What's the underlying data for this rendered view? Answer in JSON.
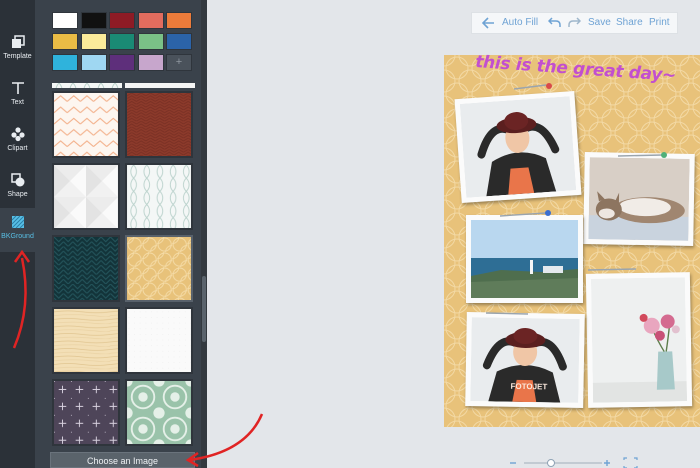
{
  "rail": {
    "items": [
      {
        "label": "Template",
        "icon": "template-icon"
      },
      {
        "label": "Text",
        "icon": "text-icon"
      },
      {
        "label": "Clipart",
        "icon": "clipart-icon"
      },
      {
        "label": "Shape",
        "icon": "shape-icon"
      },
      {
        "label": "BKGround",
        "icon": "background-icon"
      }
    ],
    "active": "BKGround"
  },
  "panel": {
    "swatch_colors": [
      [
        "#ffffff",
        "#111111",
        "#8e1b25",
        "#e26c5e",
        "#ec7b3a"
      ],
      [
        "#eabc45",
        "#fbeb9a",
        "#1a8a74",
        "#7ac187",
        "#2b63a8"
      ],
      [
        "#2fb3dc",
        "#9fd7f2",
        "#5e2f7b",
        "#c7a6cc",
        "add"
      ]
    ],
    "add_swatch_label": "+",
    "choose_image_label": "Choose an Image"
  },
  "actionbar": {
    "autofill_label": "Auto Fill",
    "save_label": "Save",
    "share_label": "Share",
    "print_label": "Print"
  },
  "canvas": {
    "title": "this is the great day~",
    "watermark": "FOTOJET"
  },
  "colors": {
    "rail_bg": "#2b3138",
    "panel_bg": "#3a424b",
    "accent": "#59c0e6",
    "canvas_bg": "#e8c27a",
    "annotation_arrow": "#e02424"
  }
}
